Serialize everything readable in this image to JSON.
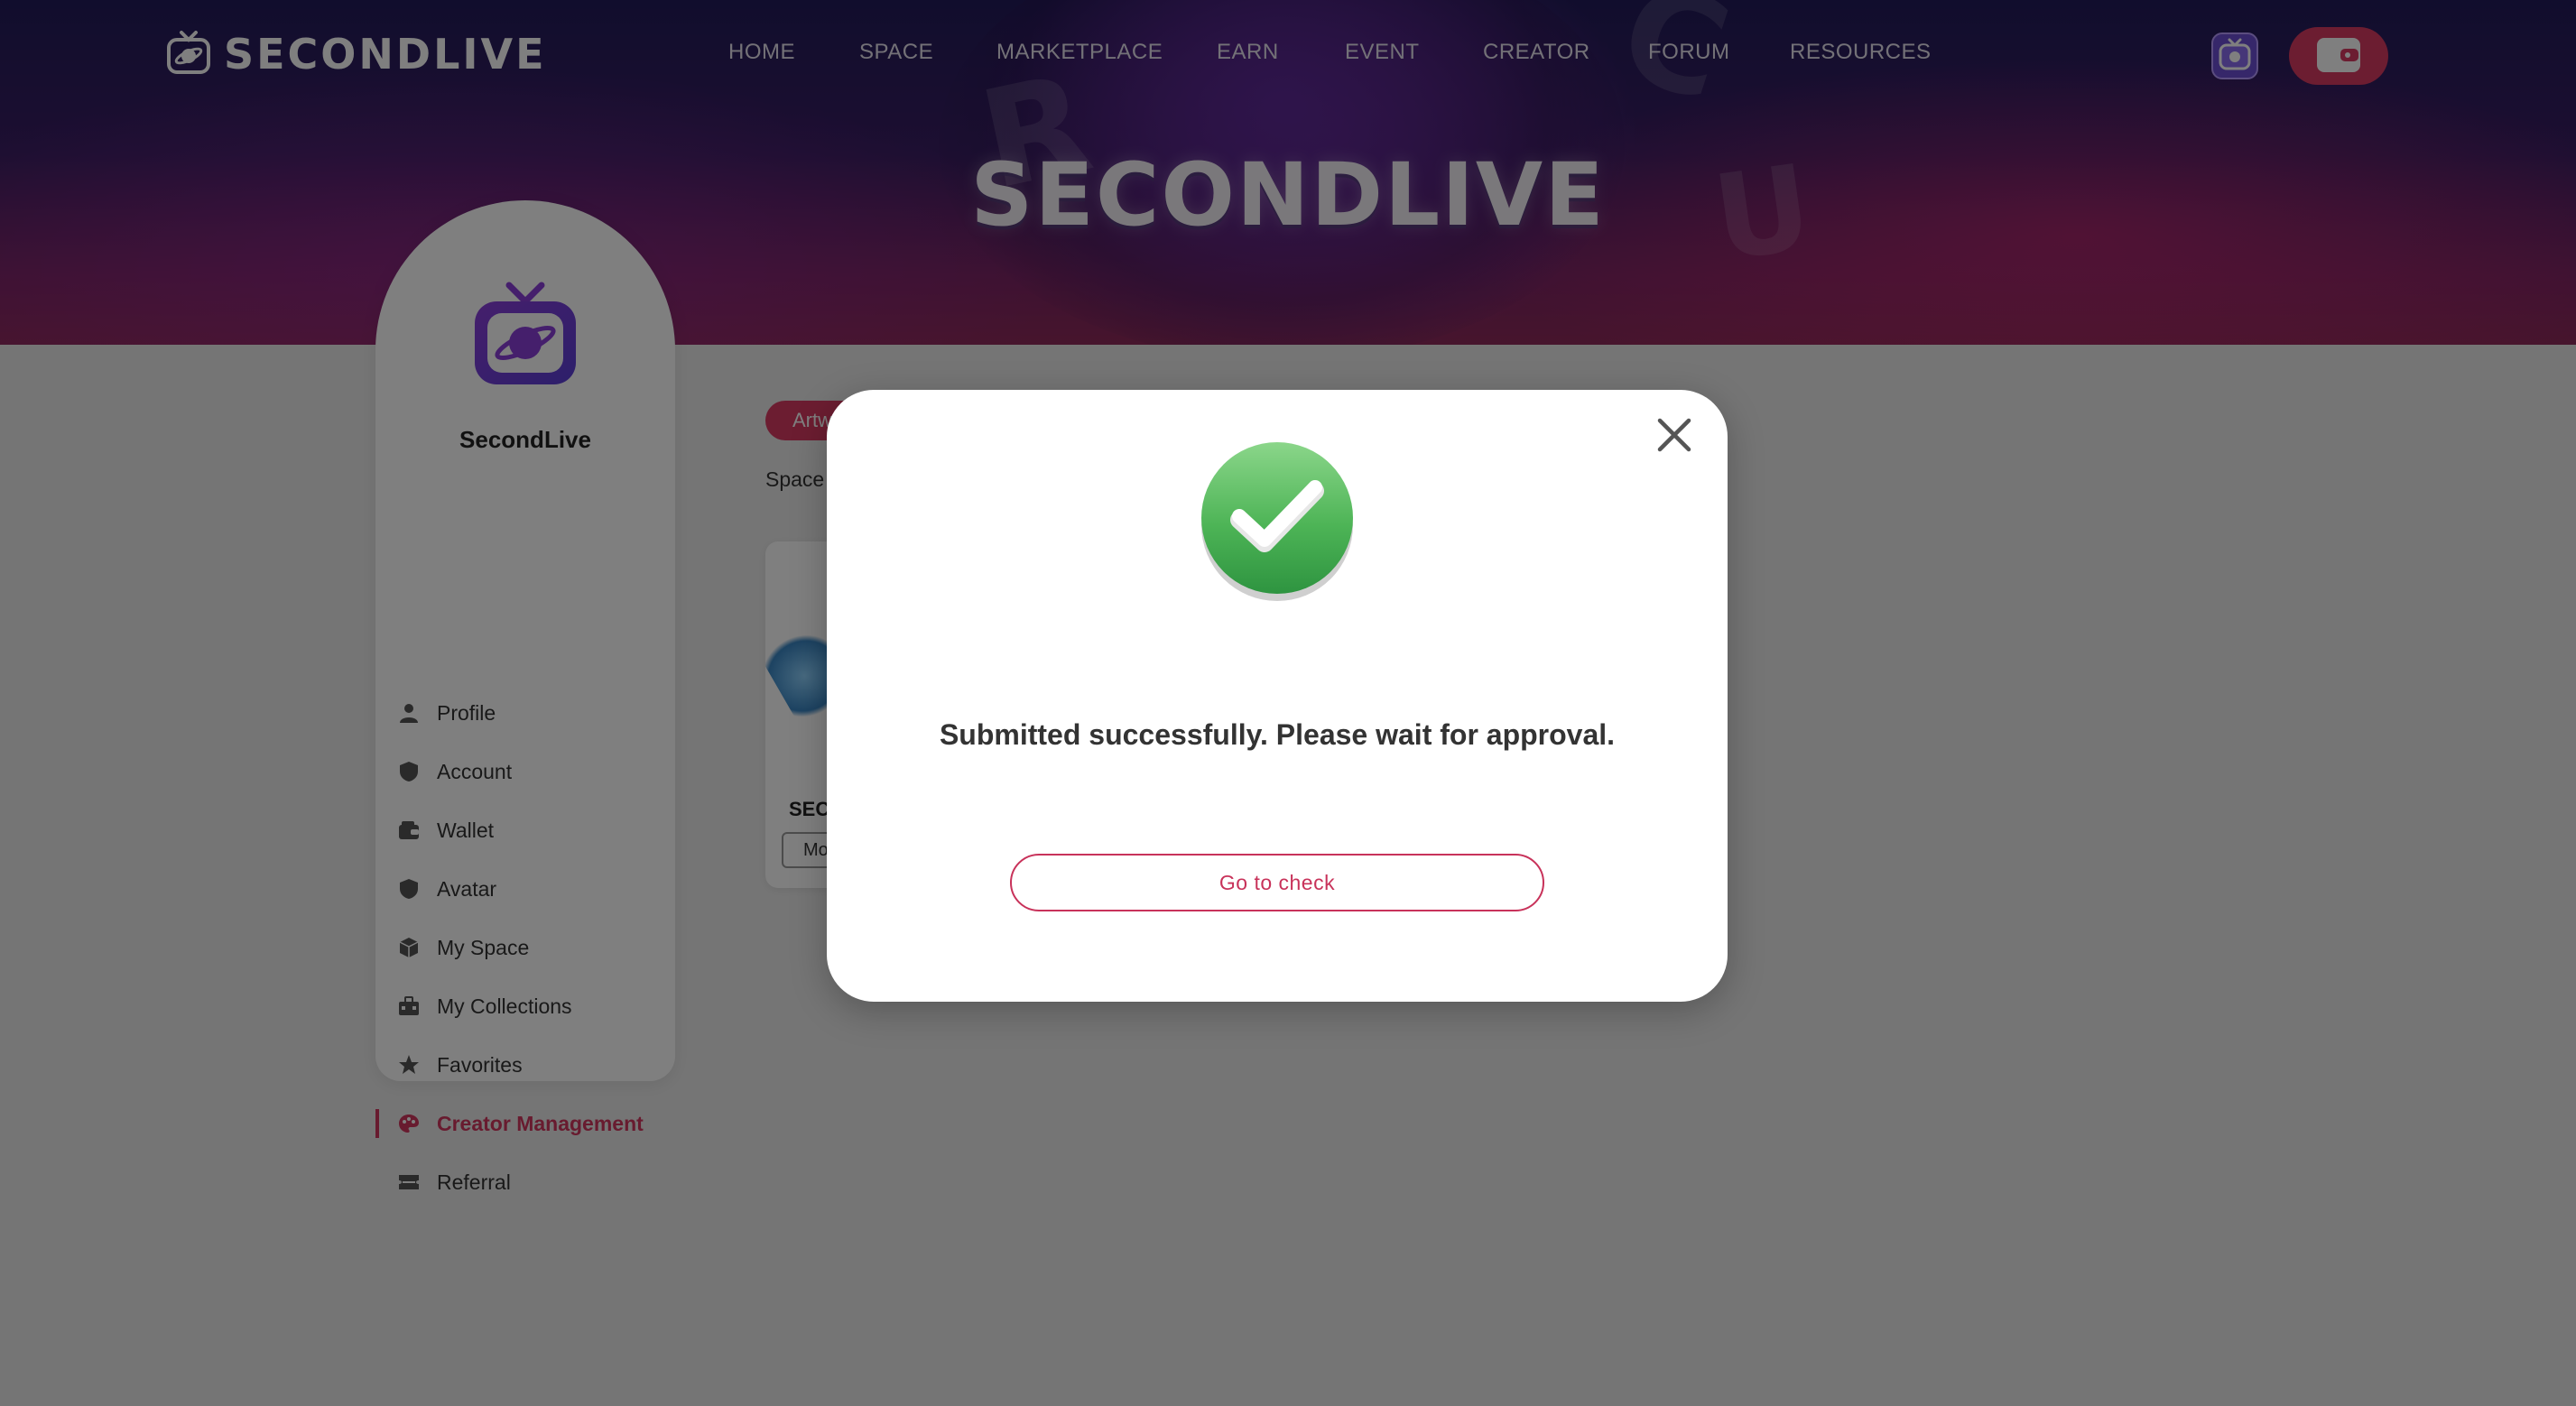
{
  "brand": {
    "logo_text": "SECONDLIVE",
    "banner_title": "SECONDLIVE",
    "accent_color": "#d83a62"
  },
  "nav": {
    "items": [
      "HOME",
      "SPACE",
      "MARKETPLACE",
      "EARN",
      "EVENT",
      "CREATOR",
      "FORUM",
      "RESOURCES"
    ]
  },
  "header": {
    "avatar_icon": "tv-planet-icon",
    "wallet_icon": "wallet-icon"
  },
  "sidebar": {
    "name": "SecondLive",
    "items": [
      {
        "label": "Profile",
        "icon": "person-icon"
      },
      {
        "label": "Account",
        "icon": "shield-icon"
      },
      {
        "label": "Wallet",
        "icon": "wallet-icon"
      },
      {
        "label": "Avatar",
        "icon": "shield-icon"
      },
      {
        "label": "My Space",
        "icon": "cube-icon"
      },
      {
        "label": "My Collections",
        "icon": "briefcase-icon"
      },
      {
        "label": "Favorites",
        "icon": "star-icon"
      },
      {
        "label": "Creator Management",
        "icon": "palette-icon",
        "active": true
      },
      {
        "label": "Referral",
        "icon": "ticket-icon"
      }
    ]
  },
  "main": {
    "tab_label": "Artw",
    "space_label": "Space",
    "card_title": "SEC",
    "card_button": "Mo"
  },
  "modal": {
    "message": "Submitted successfully. Please wait for approval.",
    "button_label": "Go to check",
    "success_icon": "check-circle-icon",
    "close_icon": "close-icon"
  }
}
